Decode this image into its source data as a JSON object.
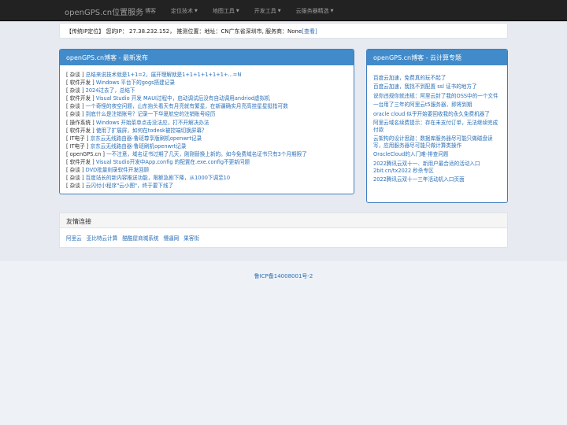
{
  "navbar": {
    "brand": "openGPS.cn位置服务",
    "items": [
      {
        "label": "博客",
        "dropdown": false
      },
      {
        "label": "定位技术",
        "dropdown": true
      },
      {
        "label": "地图工具",
        "dropdown": true
      },
      {
        "label": "开发工具",
        "dropdown": true
      },
      {
        "label": "云服务器精选",
        "dropdown": true
      }
    ]
  },
  "ip_bar": {
    "text": "【传统IP定位】 您的IP： 27.38.232.152， 推测位置：地址：CN广东省深圳市, 服务商：None",
    "link": "[查看]"
  },
  "blog_panel": {
    "title": "openGPS.cn博客 - 最新发布",
    "items": [
      {
        "tag": "[ 杂谈 ]",
        "title": "总结来说技术就是1+1=2，展开理解就是1+1+1+1+1+1+...=N"
      },
      {
        "tag": "[ 软件开发 ]",
        "title": "Windows 平台下的gogs搭建记录"
      },
      {
        "tag": "[ 杂谈 ]",
        "title": "2024过去了，总结下"
      },
      {
        "tag": "[ 软件开发 ]",
        "title": "Visual Studio 开发 MAUI过程中，启动调试后没有自动调用andriod虚拟机"
      },
      {
        "tag": "[ 杂谈 ]",
        "title": "一个奇怪的夜空问题，山东抬头看天有月亮就有繁星，在新疆确实月亮高挂星星挺指可数"
      },
      {
        "tag": "[ 杂谈 ]",
        "title": "到底什么是注销账号？记录一下华夏航空的注销账号经历"
      },
      {
        "tag": "[ 操作系统 ]",
        "title": "Windows 开始菜单点击没法应，打不开解决办法"
      },
      {
        "tag": "[ 软件开发 ]",
        "title": "使用了扩展屏，如何在todesk被控端切换屏幕？"
      },
      {
        "tag": "[ IT电子 ]",
        "title": "京东云无线路由器-鲁班尊享版刷机openwrt记录"
      },
      {
        "tag": "[ IT电子 ]",
        "title": "京东云无线路由器-鲁班刷机openwrt记录"
      },
      {
        "tag": "[ openGPS.cn ]",
        "title": "一不注意，域名证书过期了几天，刚刚替换上新的。如今免费域名证书只有3个月期限了"
      },
      {
        "tag": "[ 软件开发 ]",
        "title": "Visual Studio开发中App.config 的配置在.exe.config不更新问题"
      },
      {
        "tag": "[ 杂谈 ]",
        "title": "DVD批量刻录软件开发回顾"
      },
      {
        "tag": "[ 杂谈 ]",
        "title": "百度站长的新内容推送功能，限额急剧下降，从1000下调至10"
      },
      {
        "tag": "[ 杂谈 ]",
        "title": "云闪付小程序\"云小图\"，终于要下线了"
      }
    ]
  },
  "cloud_panel": {
    "title": "openGPS.cn博客 - 云计算专题",
    "items": [
      "百度云加速，免费真的玩不起了",
      "百度云加速，我找不到配置 ssl 证书的地方了",
      "说你违规你就违规：阿里云封了我的OSS中的一个文件",
      "一台用了三年的阿里云t5服务器，即将到期",
      "oracle cloud 似乎开始要回收我的永久免费机器了",
      "阿里云域名续费提示：存在未支付订单，无法继续完成付款",
      "云架构的设计思路：数据库服务器尽可能只做磁盘读写，应用服务器尽可能只做计算类操作",
      "OracleCloud的入门难-排查问题",
      "2022腾讯云双十一、新用户最合适的活动入口 2bit.cn/tx2022 秒杀专区",
      "2022腾讯云双十一三年活动机入口页面"
    ]
  },
  "friends": {
    "title": "友情连接",
    "links": [
      "阿里云",
      "亚比特云计算",
      "酷酷屋商城系统",
      "懵逼网",
      "果客街"
    ]
  },
  "footer": {
    "icp": "鲁ICP备14008001号-2"
  }
}
